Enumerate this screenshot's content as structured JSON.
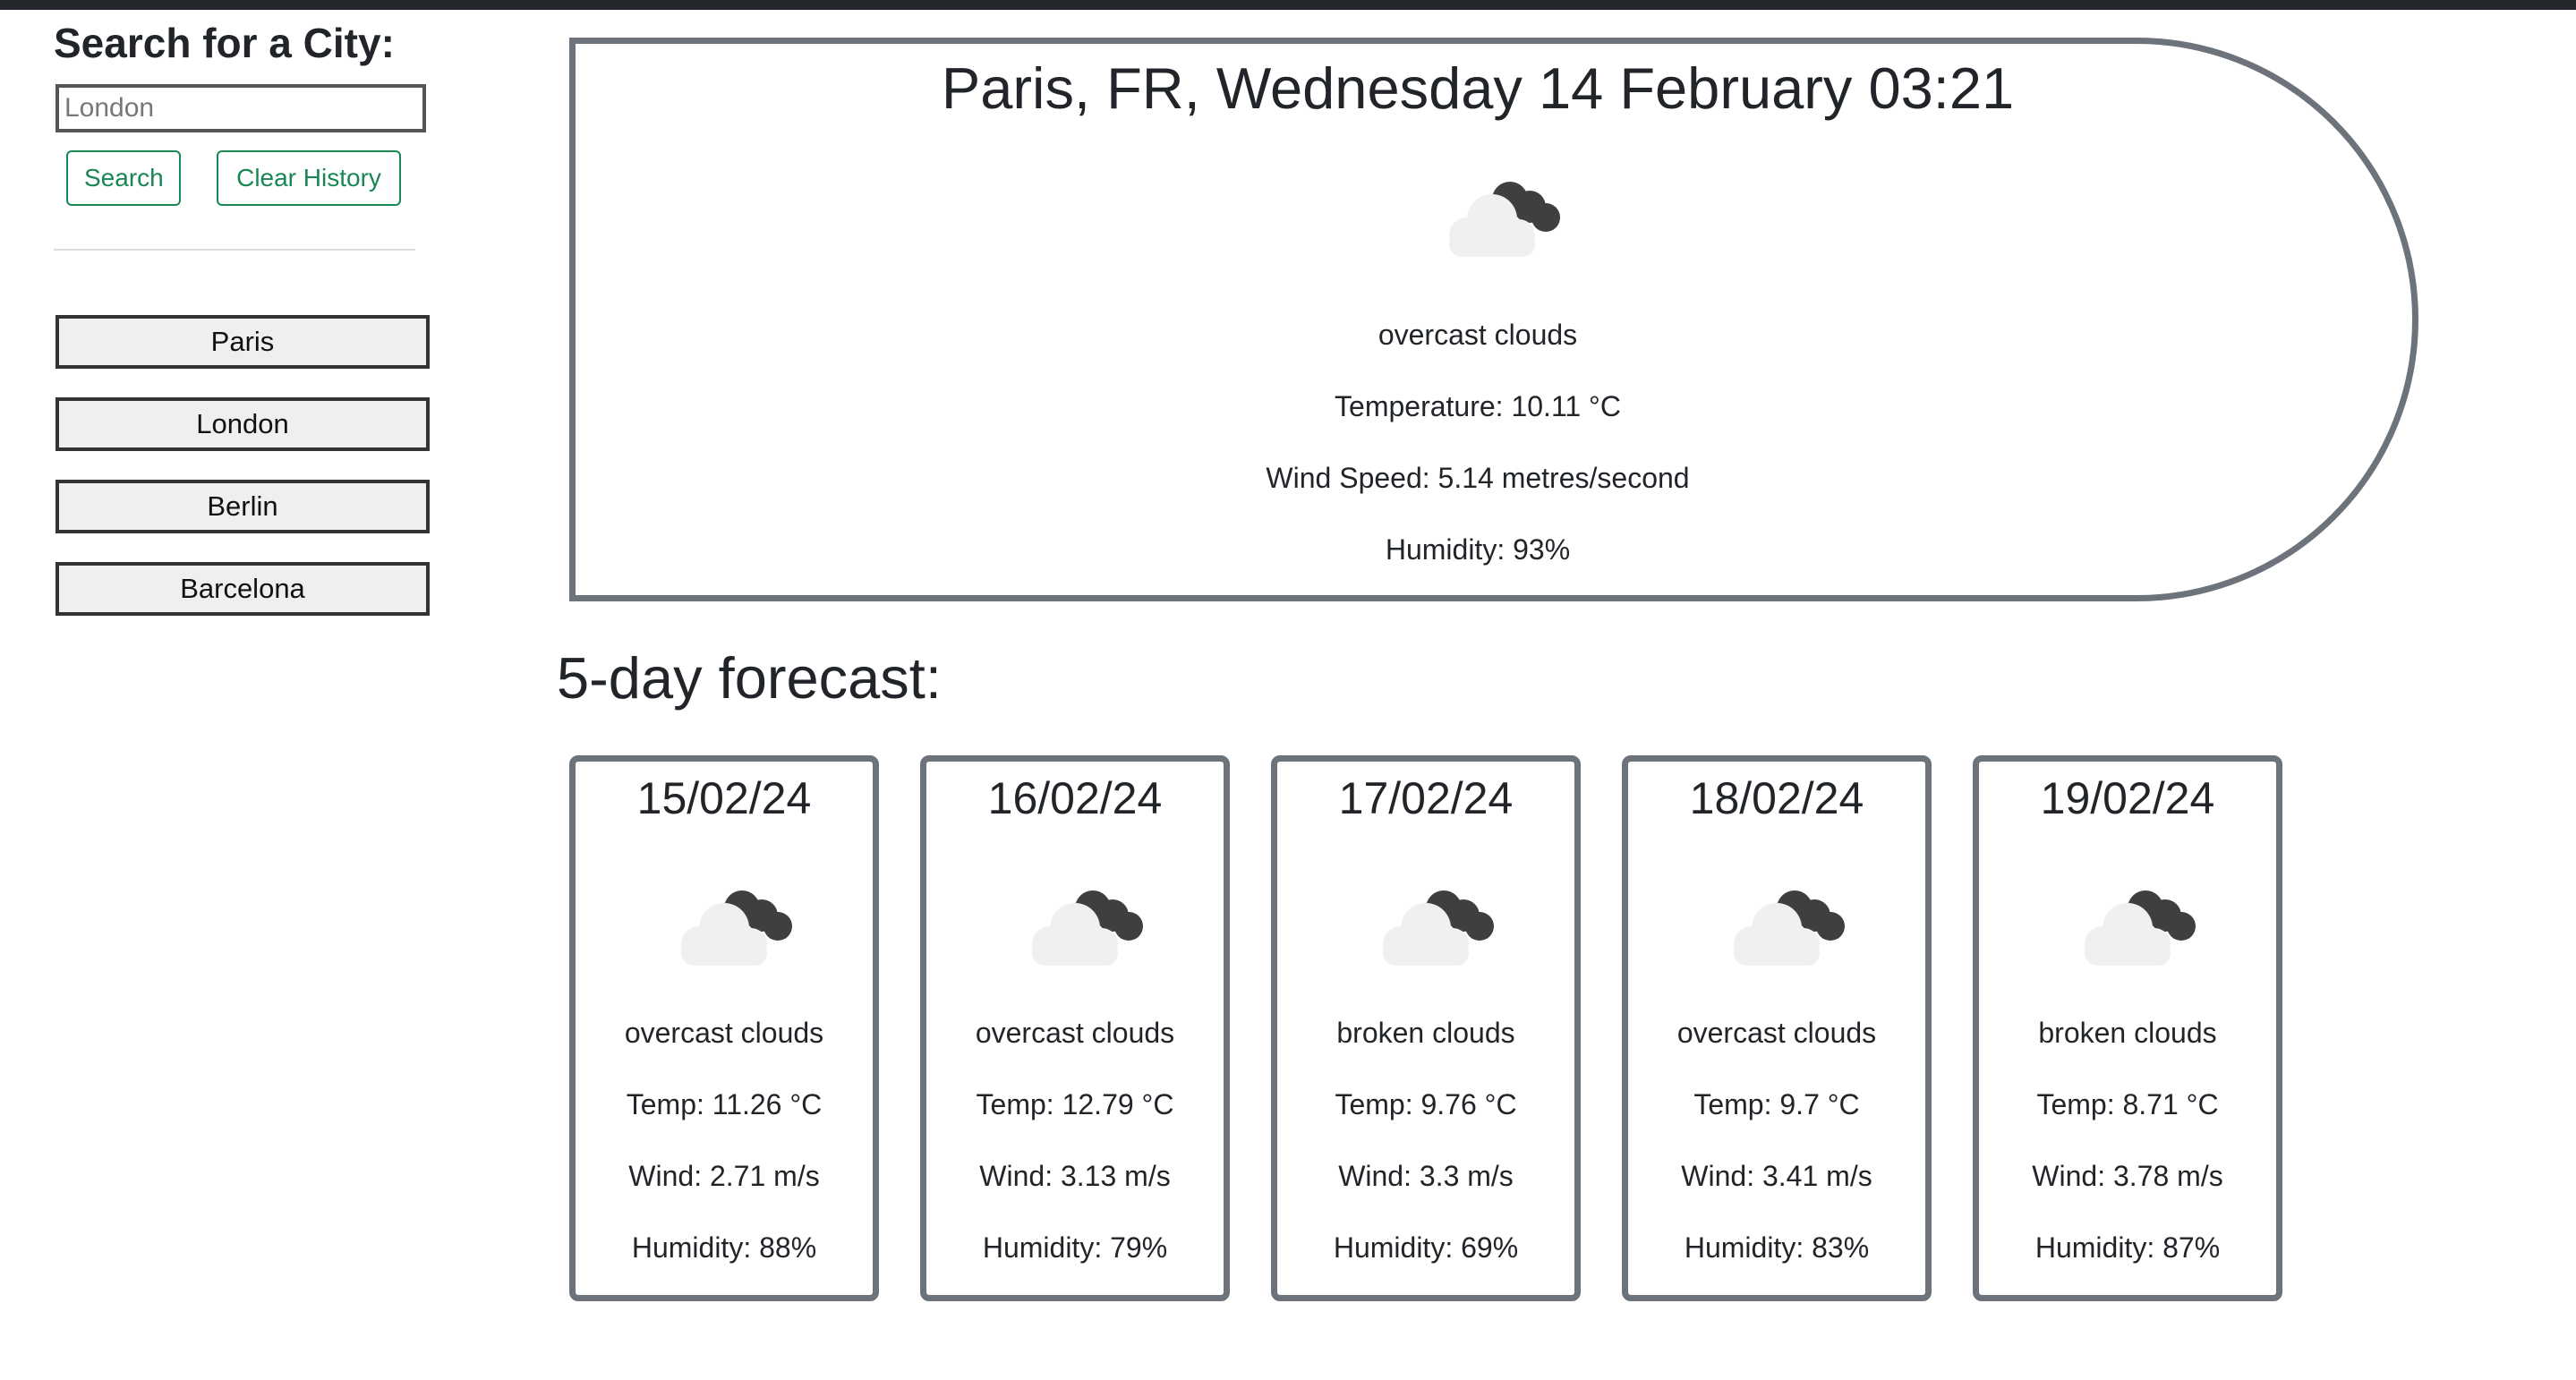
{
  "sidebar": {
    "heading": "Search for a City:",
    "search_placeholder": "London",
    "search_button": "Search",
    "clear_button": "Clear History",
    "history": [
      "Paris",
      "London",
      "Berlin",
      "Barcelona"
    ]
  },
  "current": {
    "title": "Paris, FR, Wednesday 14 February 03:21",
    "icon": "overcast-clouds-icon",
    "description": "overcast clouds",
    "temperature": "Temperature: 10.11 °C",
    "wind": "Wind Speed: 5.14 metres/second",
    "humidity": "Humidity: 93%"
  },
  "forecast": {
    "heading": "5-day forecast:",
    "days": [
      {
        "date": "15/02/24",
        "description": "overcast clouds",
        "temp": "Temp: 11.26 °C",
        "wind": "Wind: 2.71 m/s",
        "humidity": "Humidity: 88%"
      },
      {
        "date": "16/02/24",
        "description": "overcast clouds",
        "temp": "Temp: 12.79 °C",
        "wind": "Wind: 3.13 m/s",
        "humidity": "Humidity: 79%"
      },
      {
        "date": "17/02/24",
        "description": "broken clouds",
        "temp": "Temp: 9.76 °C",
        "wind": "Wind: 3.3 m/s",
        "humidity": "Humidity: 69%"
      },
      {
        "date": "18/02/24",
        "description": "overcast clouds",
        "temp": "Temp: 9.7 °C",
        "wind": "Wind: 3.41 m/s",
        "humidity": "Humidity: 83%"
      },
      {
        "date": "19/02/24",
        "description": "broken clouds",
        "temp": "Temp: 8.71 °C",
        "wind": "Wind: 3.78 m/s",
        "humidity": "Humidity: 87%"
      }
    ]
  },
  "colors": {
    "accent_green": "#198754",
    "card_border": "#6c737a",
    "top_bar": "#24272b"
  }
}
